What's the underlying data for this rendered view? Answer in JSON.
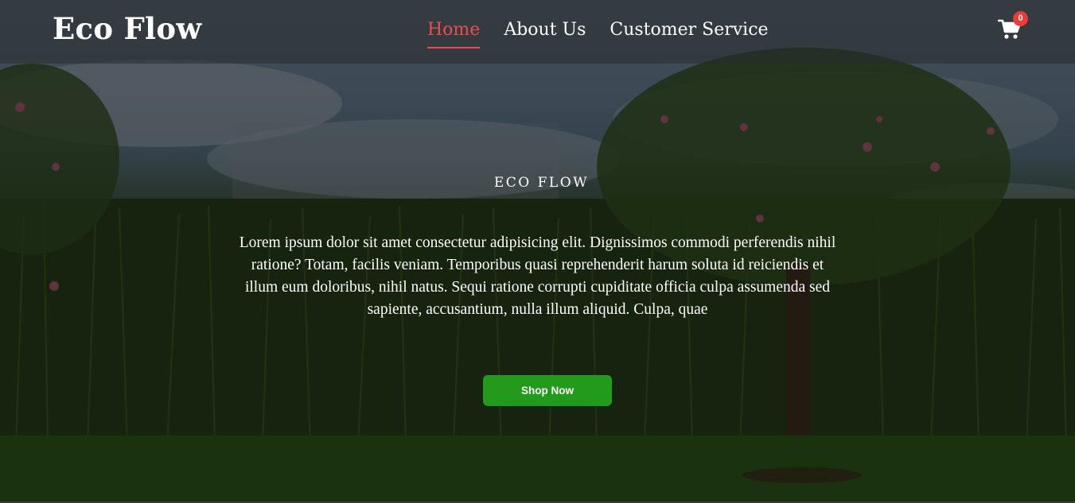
{
  "brand": {
    "name": "Eco Flow"
  },
  "nav": {
    "items": [
      {
        "label": "Home",
        "active": true
      },
      {
        "label": "About Us",
        "active": false
      },
      {
        "label": "Customer Service",
        "active": false
      }
    ],
    "active_color": "#f04b4b"
  },
  "cart": {
    "icon": "cart-icon",
    "count": "0",
    "badge_color": "#ef3a3a"
  },
  "hero": {
    "eyebrow": "ECO FLOW",
    "description": "Lorem ipsum dolor sit amet consectetur adipisicing elit. Dignissimos commodi perferendis nihil ratione? Totam, facilis veniam. Temporibus quasi reprehenderit harum soluta id reiciendis et illum eum doloribus, nihil natus. Sequi ratione corrupti cupiditate officia culpa assumenda sed sapiente, accusantium, nulla illum aliquid. Culpa, quae",
    "cta_label": "Shop Now",
    "cta_color": "#229a1b"
  }
}
